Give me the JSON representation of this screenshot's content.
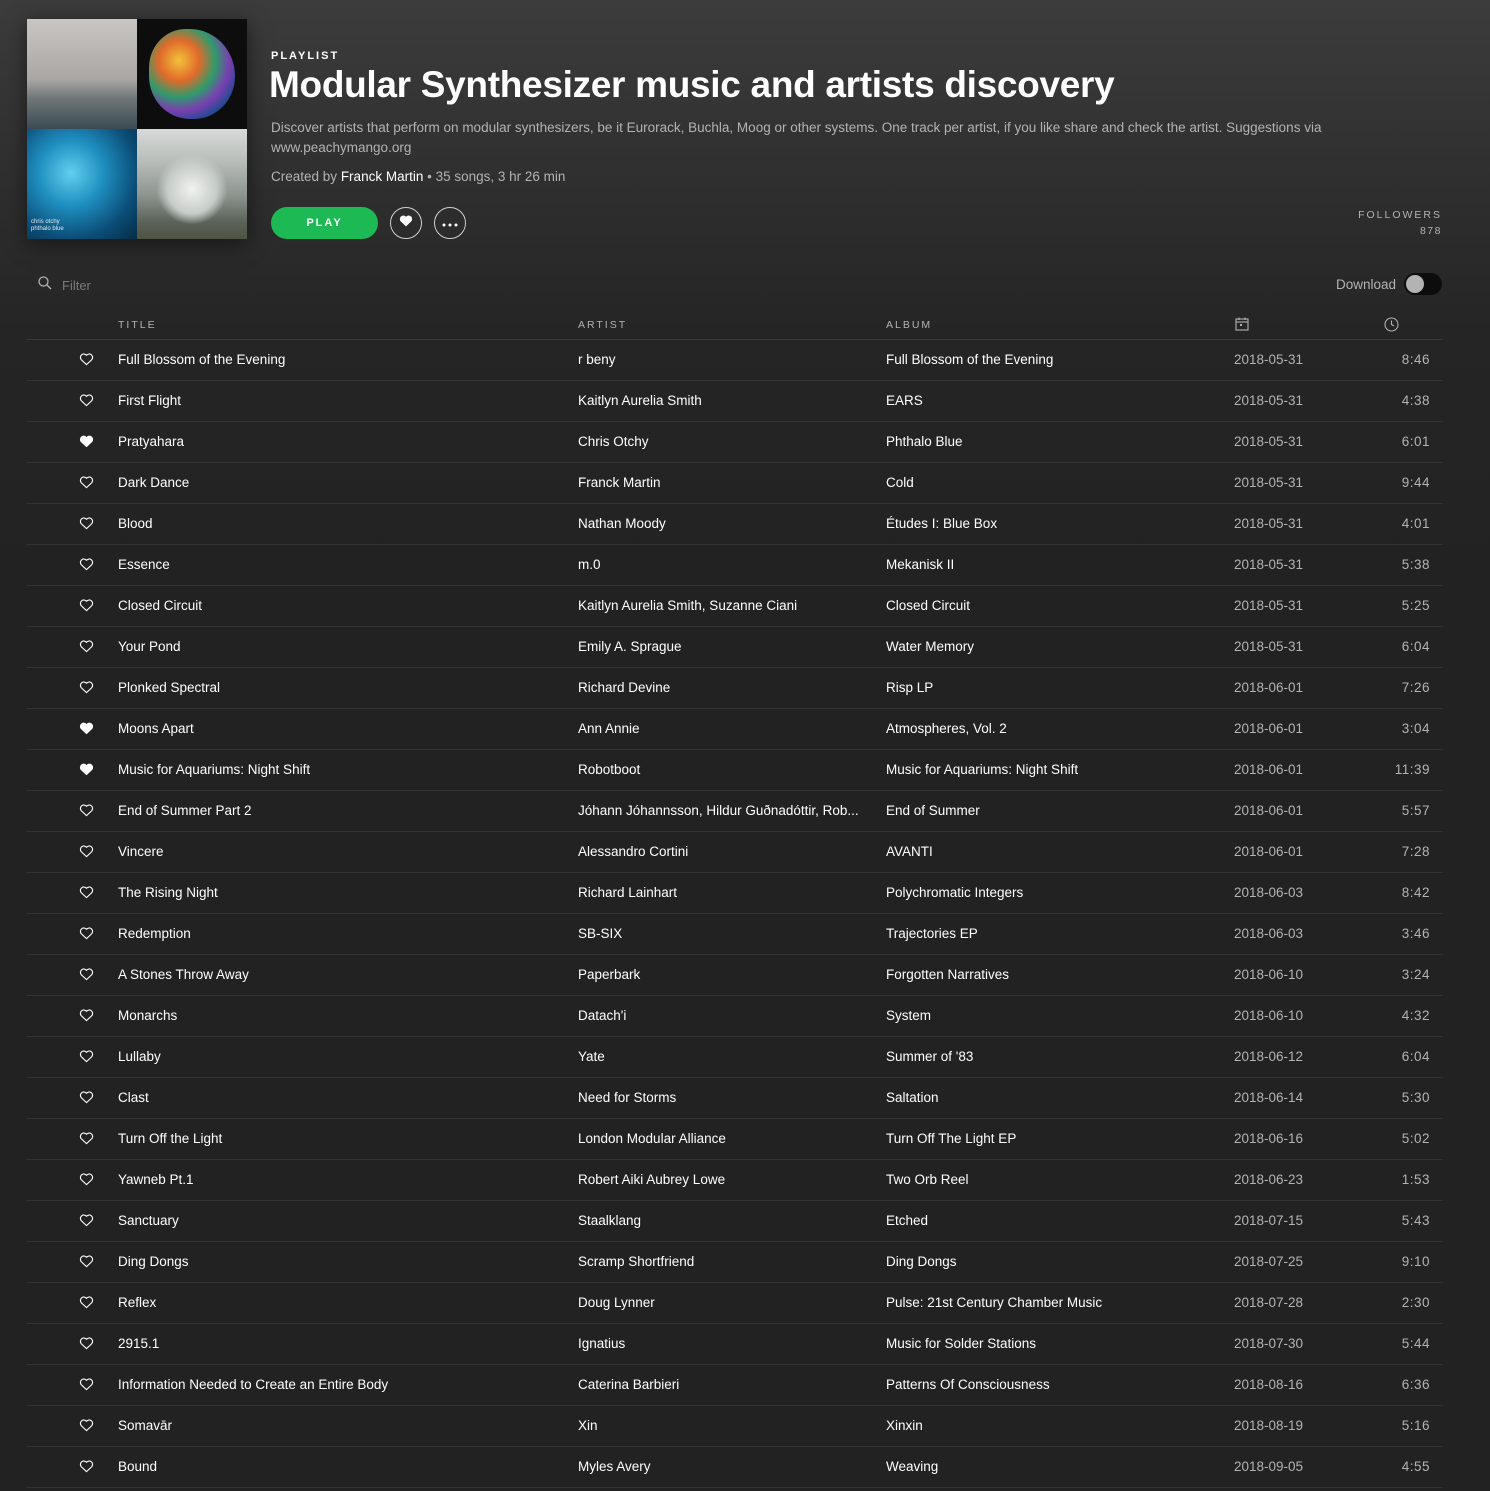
{
  "header": {
    "type_label": "PLAYLIST",
    "title": "Modular Synthesizer music and artists discovery",
    "description": "Discover artists that perform on modular synthesizers, be it Eurorack, Buchla, Moog or other systems. One track per artist, if you like share and check the artist. Suggestions via www.peachymango.org",
    "created_by_prefix": "Created by",
    "creator": "Franck Martin",
    "stats": " • 35 songs, 3 hr 26 min",
    "play_label": "PLAY",
    "followers_label": "FOLLOWERS",
    "followers_count": "878",
    "cover_caption_line1": "chris otchy",
    "cover_caption_line2": "phthalo blue"
  },
  "toolbar": {
    "filter_placeholder": "Filter",
    "download_label": "Download",
    "download_on": false
  },
  "columns": {
    "title": "TITLE",
    "artist": "ARTIST",
    "album": "ALBUM",
    "date_icon": "calendar-icon",
    "duration_icon": "clock-icon"
  },
  "colors": {
    "accent": "#1db954",
    "background": "#222222",
    "muted_text": "#b3b3b3"
  },
  "tracks": [
    {
      "liked": false,
      "title": "Full Blossom of the Evening",
      "artist": "r beny",
      "album": "Full Blossom of the Evening",
      "date": "2018-05-31",
      "duration": "8:46"
    },
    {
      "liked": false,
      "title": "First Flight",
      "artist": "Kaitlyn Aurelia Smith",
      "album": "EARS",
      "date": "2018-05-31",
      "duration": "4:38"
    },
    {
      "liked": true,
      "title": "Pratyahara",
      "artist": "Chris Otchy",
      "album": "Phthalo Blue",
      "date": "2018-05-31",
      "duration": "6:01"
    },
    {
      "liked": false,
      "title": "Dark Dance",
      "artist": "Franck Martin",
      "album": "Cold",
      "date": "2018-05-31",
      "duration": "9:44"
    },
    {
      "liked": false,
      "title": "Blood",
      "artist": "Nathan Moody",
      "album": "Études I: Blue Box",
      "date": "2018-05-31",
      "duration": "4:01"
    },
    {
      "liked": false,
      "title": "Essence",
      "artist": "m.0",
      "album": "Mekanisk II",
      "date": "2018-05-31",
      "duration": "5:38"
    },
    {
      "liked": false,
      "title": "Closed Circuit",
      "artist": "Kaitlyn Aurelia Smith, Suzanne Ciani",
      "album": "Closed Circuit",
      "date": "2018-05-31",
      "duration": "5:25"
    },
    {
      "liked": false,
      "title": "Your Pond",
      "artist": "Emily A. Sprague",
      "album": "Water Memory",
      "date": "2018-05-31",
      "duration": "6:04"
    },
    {
      "liked": false,
      "title": "Plonked Spectral",
      "artist": "Richard Devine",
      "album": "Risp LP",
      "date": "2018-06-01",
      "duration": "7:26"
    },
    {
      "liked": true,
      "title": "Moons Apart",
      "artist": "Ann Annie",
      "album": "Atmospheres, Vol. 2",
      "date": "2018-06-01",
      "duration": "3:04"
    },
    {
      "liked": true,
      "title": "Music for Aquariums: Night Shift",
      "artist": "Robotboot",
      "album": "Music for Aquariums: Night Shift",
      "date": "2018-06-01",
      "duration": "11:39"
    },
    {
      "liked": false,
      "title": "End of Summer Part 2",
      "artist": "Jóhann Jóhannsson, Hildur Guðnadóttir, Rob...",
      "album": "End of Summer",
      "date": "2018-06-01",
      "duration": "5:57"
    },
    {
      "liked": false,
      "title": "Vincere",
      "artist": "Alessandro Cortini",
      "album": "AVANTI",
      "date": "2018-06-01",
      "duration": "7:28"
    },
    {
      "liked": false,
      "title": "The Rising Night",
      "artist": "Richard Lainhart",
      "album": "Polychromatic Integers",
      "date": "2018-06-03",
      "duration": "8:42"
    },
    {
      "liked": false,
      "title": "Redemption",
      "artist": "SB-SIX",
      "album": "Trajectories EP",
      "date": "2018-06-03",
      "duration": "3:46"
    },
    {
      "liked": false,
      "title": "A Stones Throw Away",
      "artist": "Paperbark",
      "album": "Forgotten Narratives",
      "date": "2018-06-10",
      "duration": "3:24"
    },
    {
      "liked": false,
      "title": "Monarchs",
      "artist": "Datach'i",
      "album": "System",
      "date": "2018-06-10",
      "duration": "4:32"
    },
    {
      "liked": false,
      "title": "Lullaby",
      "artist": "Yate",
      "album": "Summer of '83",
      "date": "2018-06-12",
      "duration": "6:04"
    },
    {
      "liked": false,
      "title": "Clast",
      "artist": "Need for Storms",
      "album": "Saltation",
      "date": "2018-06-14",
      "duration": "5:30"
    },
    {
      "liked": false,
      "title": "Turn Off the Light",
      "artist": "London Modular Alliance",
      "album": "Turn Off The Light EP",
      "date": "2018-06-16",
      "duration": "5:02"
    },
    {
      "liked": false,
      "title": "Yawneb Pt.1",
      "artist": "Robert Aiki Aubrey Lowe",
      "album": "Two Orb Reel",
      "date": "2018-06-23",
      "duration": "1:53"
    },
    {
      "liked": false,
      "title": "Sanctuary",
      "artist": "Staalklang",
      "album": "Etched",
      "date": "2018-07-15",
      "duration": "5:43"
    },
    {
      "liked": false,
      "title": "Ding Dongs",
      "artist": "Scramp Shortfriend",
      "album": "Ding Dongs",
      "date": "2018-07-25",
      "duration": "9:10"
    },
    {
      "liked": false,
      "title": "Reflex",
      "artist": "Doug Lynner",
      "album": "Pulse: 21st Century Chamber Music",
      "date": "2018-07-28",
      "duration": "2:30"
    },
    {
      "liked": false,
      "title": "2915.1",
      "artist": "Ignatius",
      "album": "Music for Solder Stations",
      "date": "2018-07-30",
      "duration": "5:44"
    },
    {
      "liked": false,
      "title": "Information Needed to Create an Entire Body",
      "artist": "Caterina Barbieri",
      "album": "Patterns Of Consciousness",
      "date": "2018-08-16",
      "duration": "6:36"
    },
    {
      "liked": false,
      "title": "Somavār",
      "artist": "Xin",
      "album": "Xinxin",
      "date": "2018-08-19",
      "duration": "5:16"
    },
    {
      "liked": false,
      "title": "Bound",
      "artist": "Myles Avery",
      "album": "Weaving",
      "date": "2018-09-05",
      "duration": "4:55"
    }
  ]
}
